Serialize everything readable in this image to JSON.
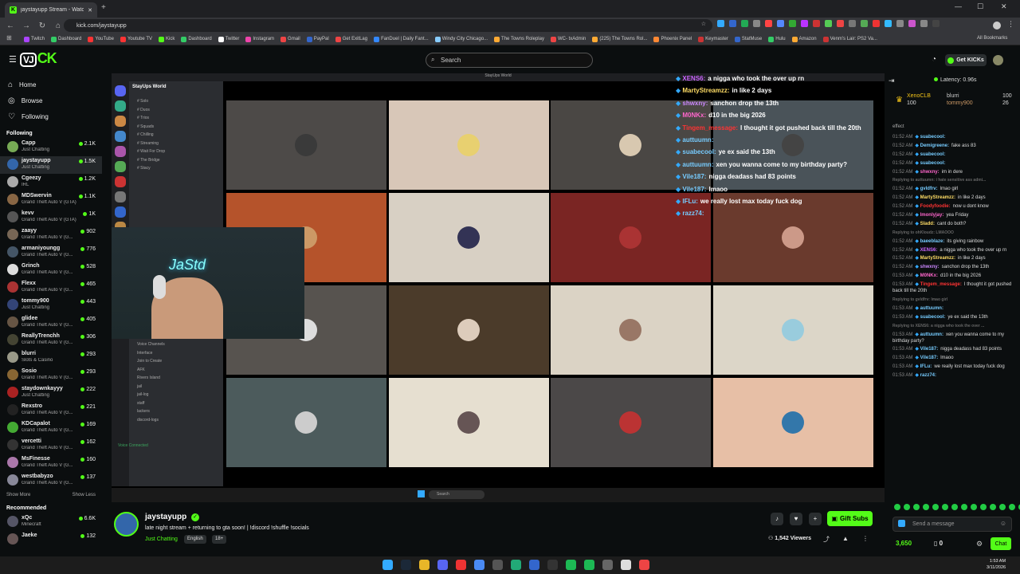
{
  "browser": {
    "tab_title": "jaystayupp Stream - Watch Live",
    "url": "kick.com/jaystayupp",
    "bookmarks": [
      "Twitch",
      "Dashboard",
      "YouTube",
      "Youtube TV",
      "Kick",
      "Dashboard",
      "Twitter",
      "Instagram",
      "Gmail",
      "PayPal",
      "Get ExitLag",
      "FanDuel | Daily Fant...",
      "Windy City Chicago...",
      "The Towns Roleplay",
      "WC- txAdmin",
      "(225) The Towns Rol...",
      "Phoenix Panel",
      "Keymaster",
      "StatMuse",
      "Hulu",
      "Amazon",
      "Venm's Lair: PS2 Va..."
    ],
    "all_bookmarks": "All Bookmarks"
  },
  "header": {
    "search_placeholder": "Search",
    "get_kicks": "Get KICKs"
  },
  "sidebar": {
    "nav": [
      {
        "label": "Home",
        "icon": "home-icon"
      },
      {
        "label": "Browse",
        "icon": "compass-icon"
      },
      {
        "label": "Following",
        "icon": "heart-icon"
      }
    ],
    "following_label": "Following",
    "channels": [
      {
        "name": "Capp",
        "game": "Just Chatting",
        "viewers": "2.1K",
        "color": "#7a5"
      },
      {
        "name": "jaystayupp",
        "game": "Just Chatting",
        "viewers": "1.5K",
        "color": "#36a"
      },
      {
        "name": "Cgeezy",
        "game": "IRL",
        "viewers": "1.2K",
        "color": "#aaa"
      },
      {
        "name": "MDSwervin",
        "game": "Grand Theft Auto V (GTA)",
        "viewers": "1.1K",
        "color": "#864"
      },
      {
        "name": "kevv",
        "game": "Grand Theft Auto V (GTA)",
        "viewers": "1K",
        "color": "#555"
      },
      {
        "name": "zaayy",
        "game": "Grand Theft Auto V (G...",
        "viewers": "902",
        "color": "#765"
      },
      {
        "name": "armaniyoungg",
        "game": "Grand Theft Auto V (G...",
        "viewers": "776",
        "color": "#456"
      },
      {
        "name": "Grinch",
        "game": "Grand Theft Auto V (G...",
        "viewers": "528",
        "color": "#ddd"
      },
      {
        "name": "Flexx",
        "game": "Grand Theft Auto V (G...",
        "viewers": "465",
        "color": "#a33"
      },
      {
        "name": "tommy900",
        "game": "Just Chatting",
        "viewers": "443",
        "color": "#347"
      },
      {
        "name": "glidee",
        "game": "Grand Theft Auto V (G...",
        "viewers": "405",
        "color": "#654"
      },
      {
        "name": "ReallyTrenchh",
        "game": "Grand Theft Auto V (G...",
        "viewers": "306",
        "color": "#443"
      },
      {
        "name": "blurri",
        "game": "Slots & Casino",
        "viewers": "293",
        "color": "#998"
      },
      {
        "name": "Sosio",
        "game": "Grand Theft Auto V (G...",
        "viewers": "293",
        "color": "#863"
      },
      {
        "name": "staydownkayyy",
        "game": "Just Chatting",
        "viewers": "222",
        "color": "#a22"
      },
      {
        "name": "Rexstro",
        "game": "Grand Theft Auto V (G...",
        "viewers": "221",
        "color": "#222"
      },
      {
        "name": "KDCapalot",
        "game": "Grand Theft Auto V (G...",
        "viewers": "169",
        "color": "#4a3"
      },
      {
        "name": "vercetti",
        "game": "Grand Theft Auto V (G...",
        "viewers": "162",
        "color": "#333"
      },
      {
        "name": "MsFinesse",
        "game": "Grand Theft Auto V (G...",
        "viewers": "160",
        "color": "#a7a"
      },
      {
        "name": "westbabyzo",
        "game": "Grand Theft Auto V (G...",
        "viewers": "137",
        "color": "#889"
      }
    ],
    "show_more": "Show More",
    "show_less": "Show Less",
    "recommended_label": "Recommended",
    "recommended": [
      {
        "name": "xQc",
        "game": "Minecraft",
        "viewers": "6.6K",
        "color": "#556"
      },
      {
        "name": "Jaeke",
        "game": "",
        "viewers": "132",
        "color": "#655"
      }
    ]
  },
  "video": {
    "discord_title": "StayUps World",
    "server_name": "StayUps World",
    "channels": [
      "Solo",
      "Duos",
      "Trios",
      "Squads",
      "Chilling",
      "Streaming",
      "Wait For Drop",
      "The Bridge",
      "Stacy"
    ],
    "voice_channels": [
      "Voice Channels",
      "Interface",
      "Join to Create",
      "AFK",
      "Rivers Island",
      "jail",
      "jail-log",
      "staff",
      "lackers",
      "discord-logs"
    ],
    "voice_connected": "Voice Connected",
    "neon_sign": "JaStd",
    "tiles": [
      {
        "bg": "#4d4a48",
        "av": "#3a3a3a"
      },
      {
        "bg": "#d8c7b8",
        "av": "#e8d070"
      },
      {
        "bg": "#4a4744",
        "av": "#d8c8b0"
      },
      {
        "bg": "#4a5359",
        "av": "#444"
      },
      {
        "bg": "#b5532b",
        "av": "#c96"
      },
      {
        "bg": "#d8d0c4",
        "av": "#335"
      },
      {
        "bg": "#7a2523",
        "av": "#a33"
      },
      {
        "bg": "#6a3a2d",
        "av": "#c98"
      },
      {
        "bg": "#57534f",
        "av": "#ddd"
      },
      {
        "bg": "#4b3b2a",
        "av": "#dcb"
      },
      {
        "bg": "#dbd3c5",
        "av": "#976"
      },
      {
        "bg": "#dcd6c8",
        "av": "#9cd"
      },
      {
        "bg": "#4c5b5c",
        "av": "#ccc"
      },
      {
        "bg": "#e6dfd0",
        "av": "#655"
      },
      {
        "bg": "#4b4848",
        "av": "#b33"
      },
      {
        "bg": "#e7bfa6",
        "av": "#37a"
      }
    ],
    "stream_chat": [
      {
        "user": "XENS6:",
        "text": "a nigga who took the over up rn",
        "color": "#c6f"
      },
      {
        "user": "MartyStreamzz:",
        "text": "in like 2 days",
        "color": "#fd6"
      },
      {
        "user": "shwxny:",
        "text": "sanchon drop the 13th",
        "color": "#c8f"
      },
      {
        "user": "M0NKx:",
        "text": "d10 in the big 2026",
        "color": "#f6c"
      },
      {
        "user": "Tingem_message:",
        "text": "I thought it got pushed back till the 20th",
        "color": "#f33"
      },
      {
        "user": "auttuumn:",
        "text": "",
        "color": "#7cf"
      },
      {
        "user": "suabecool:",
        "text": "ye ex said the 13th",
        "color": "#7cf"
      },
      {
        "user": "auttuumn:",
        "text": "xen you wanna come to my birthday party?",
        "color": "#7cf"
      },
      {
        "user": "Vile187:",
        "text": "nigga deadass had 83 points",
        "color": "#7cf"
      },
      {
        "user": "Vile187:",
        "text": "lmaoo",
        "color": "#7cf"
      },
      {
        "user": "IFLu:",
        "text": "we really lost max today fuck dog",
        "color": "#7cf"
      },
      {
        "user": "razz74:",
        "text": "",
        "color": "#7cf"
      }
    ],
    "taskbar_search": "Search"
  },
  "stream": {
    "username": "jaystayupp",
    "title": "late night stream + returning to gta soon! | !discord !shuffle !socials",
    "category": "Just Chatting",
    "tags": [
      "English",
      "18+"
    ],
    "gift_subs": "Gift Subs",
    "viewers": "1,542 Viewers"
  },
  "chat": {
    "latency": "Latency: 0.96s",
    "leaderboard": [
      {
        "name": "XenoCLB",
        "amount": "100"
      },
      {
        "name": "blurri",
        "amount": "100"
      },
      {
        "name": "tommy900",
        "amount": "26"
      }
    ],
    "leader_extra": "100",
    "top_word": "effect",
    "messages": [
      {
        "time": "01:52 AM",
        "user": "suabecool:",
        "text": "",
        "color": "#7cf"
      },
      {
        "time": "01:52 AM",
        "user": "Demigreene:",
        "text": "fake ass 83",
        "color": "#7cf"
      },
      {
        "time": "01:52 AM",
        "user": "suabecool:",
        "text": "",
        "color": "#7cf"
      },
      {
        "time": "01:52 AM",
        "user": "suabecool:",
        "text": "",
        "color": "#7cf"
      },
      {
        "time": "01:52 AM",
        "user": "shwxny:",
        "text": "im in dere",
        "color": "#f6c"
      },
      {
        "time": "",
        "user": "Replying to auttuumn: i hate sensitive ass admi...",
        "text": "",
        "color": "#666",
        "reply": true
      },
      {
        "time": "01:52 AM",
        "user": "gvldfrv:",
        "text": "lmao girl",
        "color": "#7cf"
      },
      {
        "time": "01:52 AM",
        "user": "MartyStreamzz:",
        "text": "in like 2 days",
        "color": "#fd6"
      },
      {
        "time": "01:52 AM",
        "user": "Foodyfoodie:",
        "text": "now u dont know",
        "color": "#f33"
      },
      {
        "time": "01:52 AM",
        "user": "lmonlyjay:",
        "text": "yea Friday",
        "color": "#f6c"
      },
      {
        "time": "01:52 AM",
        "user": "Sladd:",
        "text": "cant do both?",
        "color": "#fd6"
      },
      {
        "time": "",
        "user": "Replying to ohKloudz: LMAOOO",
        "text": "",
        "color": "#666",
        "reply": true
      },
      {
        "time": "01:52 AM",
        "user": "baeeblaze:",
        "text": "its giving rainbow",
        "color": "#7cf"
      },
      {
        "time": "01:52 AM",
        "user": "XENS6:",
        "text": "a nigga who took the over up rn",
        "color": "#c6f"
      },
      {
        "time": "01:52 AM",
        "user": "MartyStreamzz:",
        "text": "in like 2 days",
        "color": "#fd6"
      },
      {
        "time": "01:52 AM",
        "user": "shwxny:",
        "text": "sanchon drop the 13th",
        "color": "#c8f"
      },
      {
        "time": "01:53 AM",
        "user": "M0NKx:",
        "text": "d10 in the big 2026",
        "color": "#f6c"
      },
      {
        "time": "01:53 AM",
        "user": "Tingem_message:",
        "text": "I thought it got pushed back till the 20th",
        "color": "#f33"
      },
      {
        "time": "",
        "user": "Replying to gvldfrv: lmao girl",
        "text": "",
        "color": "#666",
        "reply": true
      },
      {
        "time": "01:53 AM",
        "user": "auttuumn:",
        "text": "",
        "color": "#7cf"
      },
      {
        "time": "01:53 AM",
        "user": "suabecool:",
        "text": "ye ex said the 13th",
        "color": "#7cf"
      },
      {
        "time": "",
        "user": "Replying to XENS6: a nigga who took the over ...",
        "text": "",
        "color": "#666",
        "reply": true
      },
      {
        "time": "01:53 AM",
        "user": "auttuumn:",
        "text": "xen you wanna come to my birthday party?",
        "color": "#7cf"
      },
      {
        "time": "01:53 AM",
        "user": "Vile187:",
        "text": "nigga deadass had 83 points",
        "color": "#7cf"
      },
      {
        "time": "01:53 AM",
        "user": "Vile187:",
        "text": "lmaoo",
        "color": "#7cf"
      },
      {
        "time": "01:53 AM",
        "user": "IFLu:",
        "text": "we really lost max today fuck dog",
        "color": "#7cf"
      },
      {
        "time": "01:53 AM",
        "user": "razz74:",
        "text": "",
        "color": "#7cf"
      }
    ],
    "input_placeholder": "Send a message",
    "kicks_count": "3,650",
    "zero_count": "0",
    "chat_button": "Chat"
  },
  "system": {
    "time": "1:53 AM",
    "date": "3/11/2026"
  }
}
